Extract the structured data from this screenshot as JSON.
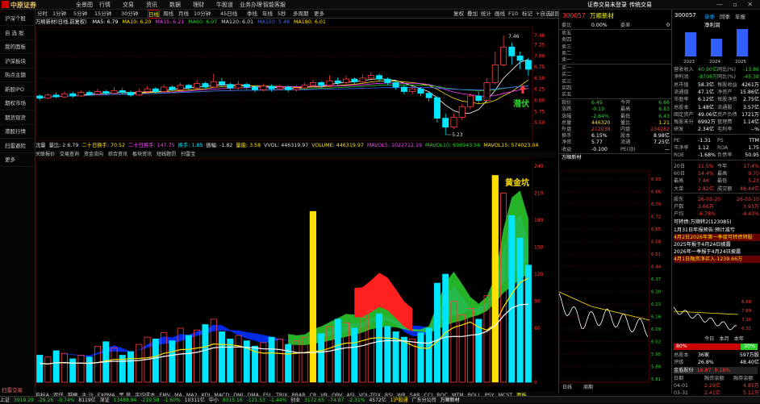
{
  "app": {
    "logo": "中原证券",
    "menus": [
      "全景图",
      "行情",
      "交易",
      "资讯",
      "数据",
      "理财",
      "牛股道",
      "业务办理",
      "智能客服"
    ],
    "right_menus": [
      "证券交易未登录",
      "传统交易"
    ],
    "window_controls": "— ▫ ✕"
  },
  "sidebar": {
    "items": [
      "沪深个股",
      "自 选 股",
      "我的面板",
      "沪深板块",
      "热点主题",
      "新股IPO",
      "期权市场",
      "期货现货",
      "港股行情",
      "扫雷避险",
      "更多"
    ],
    "bottom": "扫雷交易"
  },
  "toolbar": {
    "left": [
      "分时",
      "1分钟",
      "5分钟",
      "15分钟",
      "30分钟",
      "日线",
      "周线",
      "月线",
      "10分钟",
      "45日线",
      "季线",
      "年线",
      "5秒",
      "多周期",
      "更多"
    ],
    "active": "日线",
    "right": [
      "复权",
      "叠加",
      "统计",
      "画线",
      "F10",
      "标记",
      "+自选",
      "返回"
    ]
  },
  "chart_header": {
    "title": "万顺新材(日线,前复权)",
    "ma": [
      {
        "label": "MA5: 6.79",
        "color": "#ffffff"
      },
      {
        "label": "MA10: 6.20",
        "color": "#ffe000"
      },
      {
        "label": "MA15: 6.21",
        "color": "#ff40ff"
      },
      {
        "label": "MA60: 6.07",
        "color": "#2dd12d"
      },
      {
        "label": "MA120: 6.01",
        "color": "#dddddd"
      },
      {
        "label": "MA150: 5.48",
        "color": "#4060ff"
      },
      {
        "label": "MA180: 6.01",
        "color": "#ffe000"
      }
    ]
  },
  "chart_data": {
    "type": "candlestick",
    "y_ticks": [
      "7.46",
      "7.25",
      "7.00",
      "6.75",
      "6.50",
      "6.25",
      "6.00",
      "5.75",
      "5.50"
    ],
    "ylim": [
      5.23,
      7.55
    ],
    "annotations": {
      "high": "7.46",
      "low": "5.23",
      "pattern_label": "潜伏",
      "volume_label": "黄金坑"
    },
    "candles": [
      [
        6.1,
        6.05,
        6.14,
        6.0
      ],
      [
        6.05,
        6.12,
        6.16,
        6.02
      ],
      [
        6.12,
        6.08,
        6.18,
        6.05
      ],
      [
        6.08,
        6.15,
        6.2,
        6.05
      ],
      [
        6.15,
        6.1,
        6.2,
        6.06
      ],
      [
        6.1,
        6.18,
        6.22,
        6.08
      ],
      [
        6.18,
        6.14,
        6.22,
        6.1
      ],
      [
        6.14,
        6.2,
        6.26,
        6.12
      ],
      [
        6.2,
        6.16,
        6.24,
        6.12
      ],
      [
        6.16,
        6.22,
        6.3,
        6.14
      ],
      [
        6.22,
        6.18,
        6.28,
        6.14
      ],
      [
        6.18,
        6.12,
        6.22,
        6.08
      ],
      [
        6.12,
        6.2,
        6.26,
        6.1
      ],
      [
        6.2,
        6.26,
        6.32,
        6.16
      ],
      [
        6.26,
        6.2,
        6.3,
        6.16
      ],
      [
        6.2,
        6.3,
        6.36,
        6.18
      ],
      [
        6.3,
        6.24,
        6.34,
        6.2
      ],
      [
        6.24,
        6.34,
        6.4,
        6.22
      ],
      [
        6.34,
        6.28,
        6.38,
        6.22
      ],
      [
        6.28,
        6.38,
        6.46,
        6.26
      ],
      [
        6.38,
        6.3,
        6.42,
        6.26
      ],
      [
        6.3,
        6.42,
        6.6,
        6.28
      ],
      [
        6.42,
        6.36,
        6.5,
        6.3
      ],
      [
        6.36,
        6.28,
        6.4,
        6.22
      ],
      [
        6.28,
        6.36,
        6.44,
        6.24
      ],
      [
        6.36,
        6.3,
        6.4,
        6.24
      ],
      [
        6.3,
        6.24,
        6.34,
        6.18
      ],
      [
        6.24,
        6.32,
        6.38,
        6.2
      ],
      [
        6.32,
        6.26,
        6.36,
        6.2
      ],
      [
        6.26,
        6.3,
        6.36,
        6.22
      ],
      [
        6.3,
        6.24,
        6.34,
        6.18
      ],
      [
        6.24,
        6.28,
        6.34,
        6.2
      ],
      [
        6.28,
        6.34,
        6.4,
        6.24
      ],
      [
        6.34,
        6.4,
        6.46,
        6.3
      ],
      [
        6.4,
        6.34,
        6.44,
        6.28
      ],
      [
        6.34,
        6.44,
        6.56,
        6.3
      ],
      [
        6.44,
        6.4,
        6.52,
        6.34
      ],
      [
        6.4,
        6.48,
        6.56,
        6.36
      ],
      [
        6.48,
        6.42,
        6.52,
        6.36
      ],
      [
        6.42,
        6.5,
        6.58,
        6.38
      ],
      [
        6.5,
        6.56,
        6.64,
        6.44
      ],
      [
        6.56,
        6.48,
        6.6,
        6.42
      ],
      [
        6.48,
        6.4,
        6.52,
        6.34
      ],
      [
        6.4,
        6.3,
        6.44,
        6.24
      ],
      [
        6.3,
        6.2,
        6.34,
        6.14
      ],
      [
        6.2,
        6.26,
        6.32,
        6.14
      ],
      [
        6.26,
        6.16,
        6.3,
        6.1
      ],
      [
        6.16,
        6.06,
        6.2,
        5.98
      ],
      [
        6.06,
        5.6,
        6.1,
        5.5
      ],
      [
        5.6,
        5.4,
        5.7,
        5.23
      ],
      [
        5.4,
        5.62,
        5.7,
        5.36
      ],
      [
        5.62,
        5.86,
        5.92,
        5.56
      ],
      [
        5.86,
        6.1,
        6.16,
        5.8
      ],
      [
        6.1,
        6.0,
        6.2,
        5.94
      ],
      [
        6.0,
        6.4,
        6.5,
        5.96
      ],
      [
        6.4,
        6.8,
        7.1,
        6.36
      ],
      [
        6.8,
        7.2,
        7.46,
        6.76
      ],
      [
        7.2,
        7.0,
        7.3,
        6.8
      ],
      [
        7.0,
        6.9,
        7.1,
        6.7
      ],
      [
        6.9,
        6.7,
        6.96,
        6.55
      ]
    ],
    "volume_ticks": [
      "0",
      "60",
      "90",
      "120",
      "150",
      "180",
      "210",
      "240"
    ],
    "volumes": [
      30,
      28,
      35,
      32,
      26,
      30,
      28,
      40,
      45,
      38,
      30,
      34,
      42,
      50,
      48,
      55,
      46,
      60,
      52,
      58,
      64,
      70,
      56,
      48,
      52,
      46,
      40,
      44,
      50,
      48,
      42,
      46,
      50,
      58,
      54,
      62,
      70,
      66,
      60,
      72,
      80,
      76,
      62,
      56,
      50,
      48,
      55,
      60,
      110,
      120,
      90,
      75,
      82,
      70,
      96,
      140,
      210,
      185,
      160,
      130
    ],
    "volume_colors": "cyan=down,red=up"
  },
  "indicators": {
    "vol_row": [
      {
        "label": "沈量",
        "color": "#dddddd"
      },
      {
        "label": "量比: 2 6.79",
        "color": "#dddddd"
      },
      {
        "label": "二十日换手: 70.52",
        "color": "#ffe000"
      },
      {
        "label": "二十日换手: 147.75",
        "color": "#ff40ff"
      },
      {
        "label": "换手: 1.85",
        "color": "#00e5ff"
      },
      {
        "label": "振幅: -1.82",
        "color": "#dddddd"
      },
      {
        "label": "量能: 3.58",
        "color": "#ffe000"
      },
      {
        "label": "VVOL: 446319.97",
        "color": "#dddddd"
      },
      {
        "label": "VOLUME: 446319.97",
        "color": "#ffe000"
      },
      {
        "label": "MAVOL5: 1022712.19",
        "color": "#ff40ff"
      },
      {
        "label": "MAVOL10: 698943.56",
        "color": "#2dd12d"
      },
      {
        "label": "MAVOL15: 574023.04",
        "color": "#ffe000"
      }
    ],
    "tabs": [
      "指标A",
      "双仔",
      "越栅",
      "主 沙",
      "EXPMA",
      "黑 量",
      "平均成本",
      "EMV",
      "MA",
      "MA2",
      "KDJ",
      "MACD",
      "DMI",
      "DMA",
      "FSL",
      "TRIX",
      "BRAR",
      "CR",
      "VR",
      "OBV",
      "ASI",
      "VOL-TDX",
      "RSI",
      "WR",
      "SAR",
      "CCI",
      "ROC",
      "MTM",
      "BOLL",
      "PSY",
      "MCST",
      "面板"
    ],
    "tabs_active": "面板",
    "bottom": [
      "关联报价",
      "交易查询",
      "资金流向",
      "综合资讯",
      "板块资讯",
      "短线题罚",
      "扫雷宝"
    ]
  },
  "quote": {
    "code": "300057",
    "name": "万顺新材",
    "rows_top": [
      {
        "l": "委比",
        "m1": "0.00%",
        "m2": "委差",
        "m3": "0"
      }
    ],
    "asks": [
      {
        "l": "卖五",
        "m1": "",
        "m3": ""
      },
      {
        "l": "卖四",
        "m1": "",
        "m3": ""
      },
      {
        "l": "卖三",
        "m1": "",
        "m3": ""
      },
      {
        "l": "卖二",
        "m1": "",
        "m3": ""
      },
      {
        "l": "卖一",
        "m1": "",
        "m3": ""
      }
    ],
    "bids": [
      {
        "l": "买一",
        "m1": "",
        "m3": ""
      },
      {
        "l": "买二",
        "m1": "",
        "m3": ""
      },
      {
        "l": "买三",
        "m1": "",
        "m3": ""
      },
      {
        "l": "买四",
        "m1": "",
        "m3": ""
      },
      {
        "l": "买五",
        "m1": "",
        "m3": ""
      }
    ],
    "stats": [
      {
        "l": "现价",
        "m1": "6.49",
        "m2": "今开",
        "m3": "6.66"
      },
      {
        "l": "涨跌",
        "m1": "-0.19",
        "m2": "最高",
        "m3": "6.83"
      },
      {
        "l": "涨幅",
        "m1": "-2.84%",
        "m2": "最低",
        "m3": "6.43"
      },
      {
        "l": "总量",
        "m1": "446320",
        "m2": "量比",
        "m3": "1.21"
      },
      {
        "l": "外盘",
        "m1": "212038",
        "m2": "内盘",
        "m3": "234282"
      },
      {
        "l": "换手",
        "m1": "6.15%",
        "m2": "股本",
        "m3": "8.98亿"
      },
      {
        "l": "净资",
        "m1": "5.77",
        "m2": "流通",
        "m3": "7.25亿"
      },
      {
        "l": "收益",
        "m1": "-0.100",
        "m2": "PE(动)",
        "m3": "—"
      }
    ],
    "tick_title": "万顺新材",
    "tick_y": [
      "6.93",
      "6.86",
      "6.79",
      "6.72",
      "6.65",
      "6.58",
      "6.51",
      "6.44",
      "6.37",
      "6.30",
      "6.23",
      "6.16",
      "6.09",
      "6.02",
      "5.95",
      "5.88",
      "5.81"
    ],
    "bottom_tabs": [
      "日线",
      "周期"
    ]
  },
  "fin": {
    "code": "300057",
    "tabs": [
      "单季",
      "同季",
      "年报"
    ],
    "chart_title": "净利润",
    "years": [
      "2023",
      "2024",
      "2025"
    ],
    "rows": [
      {
        "a": "营收收入",
        "b": "40.90亿",
        "c": "同比(%)",
        "d": "-13.86"
      },
      {
        "a": "净利润",
        "b": "-8708万",
        "c": "同比(%)",
        "d": "-45.38"
      },
      {
        "a": "总市值",
        "b": "58.3亿",
        "c": "每股收益",
        "d": "4261万"
      },
      {
        "a": "流通值",
        "b": "47.1亿",
        "c": "净资产",
        "d": "15.86亿"
      },
      {
        "a": "市盈率",
        "b": "6.12亿",
        "c": "每股净资",
        "d": "2.75亿"
      },
      {
        "a": "总股本",
        "b": "1.48亿",
        "c": "流通股",
        "d": "3.57亿"
      },
      {
        "a": "固定资产",
        "b": "49.06亿",
        "c": "资产负债",
        "d": "1721万"
      },
      {
        "a": "每股未分",
        "b": "6992万",
        "c": "管理费",
        "d": "1.14亿"
      },
      {
        "a": "研发",
        "b": "2.34亿",
        "c": "毛利率",
        "d": "--%"
      }
    ],
    "rows2": [
      {
        "a": "PE",
        "b": "-1.31",
        "c": "PS",
        "d": "TTM"
      },
      {
        "a": "市净率",
        "b": "1.12",
        "c": "ROA",
        "d": "1.75"
      },
      {
        "a": "ROE",
        "b": "-1.68%",
        "c": "负债率",
        "d": "50.95"
      }
    ],
    "rows3": [
      {
        "a": "20日",
        "b": "11.5%",
        "c": "今年",
        "d": "17.4%"
      },
      {
        "a": "60日",
        "b": "14.4%",
        "c": "最高",
        "d": "9.70"
      },
      {
        "a": "最高",
        "b": "7.46",
        "c": "最低",
        "d": "5.23"
      },
      {
        "a": "大单",
        "b": "2.82亿",
        "c": "成交额",
        "d": "48.44亿"
      }
    ],
    "rows4": [
      {
        "a": "股东",
        "b": "26-03-20",
        "c": "",
        "d": "26-03-10"
      },
      {
        "a": "户数",
        "b": "3.66万",
        "c": "",
        "d": "3.93万"
      },
      {
        "a": "户均",
        "b": "-6.78%",
        "c": "",
        "d": "-4.43%"
      }
    ],
    "notice": "可转债:万顺转2(123085)",
    "news": [
      {
        "t": "1月31日年报预告:预计减亏",
        "color": "#ffffff"
      },
      {
        "t": "4月2日2026年第一季度可转债转股",
        "color": "#ffe000"
      },
      {
        "t": "2025年报于4月24日披露",
        "color": "#ffffff"
      },
      {
        "t": "2026年一季报于4月24日披露",
        "color": "#ffffff"
      },
      {
        "t": "4月1日融资净买入-1239.66万",
        "color": "#ffe000"
      }
    ],
    "mini_y": [
      "8.68",
      "7.89",
      "7.10",
      "6.31"
    ],
    "tabs2": [
      "今日",
      "本月",
      "本年"
    ],
    "gauge": {
      "left": "80%",
      "right": "20%",
      "left_frac": 0.8
    },
    "stats2": [
      {
        "a": "总股本",
        "b": "36家",
        "c": "",
        "d": "597万股"
      },
      {
        "a": "评级",
        "b": "26.8%",
        "c": "",
        "d": "48.40亿"
      }
    ],
    "compare": {
      "name": "金盾股份",
      "v1": "10.87",
      "v2": "0.18%"
    },
    "table_head": [
      "日期",
      "融资余额",
      "融券余额"
    ],
    "table": [
      {
        "a": "04-01",
        "b": "2.29亿",
        "d": "4.85万"
      },
      {
        "a": "03-31",
        "b": "2.41亿",
        "d": "5.12万"
      },
      {
        "a": "03-30",
        "b": "2.38亿",
        "d": "5.01万"
      }
    ]
  },
  "status": {
    "items": [
      {
        "t": "上证",
        "c": "#dddddd"
      },
      {
        "t": "3919.29",
        "c": "#2dd12d"
      },
      {
        "t": "-29.26",
        "c": "#2dd12d"
      },
      {
        "t": "-0.74%",
        "c": "#2dd12d"
      },
      {
        "t": "8119亿",
        "c": "#dddddd"
      },
      {
        "t": "深证",
        "c": "#dddddd"
      },
      {
        "t": "13488.94",
        "c": "#2dd12d"
      },
      {
        "t": "-219.58",
        "c": "#2dd12d"
      },
      {
        "t": "-1.60%",
        "c": "#2dd12d"
      },
      {
        "t": "10311亿",
        "c": "#dddddd"
      },
      {
        "t": "中小",
        "c": "#dddddd"
      },
      {
        "t": "8315.16",
        "c": "#2dd12d"
      },
      {
        "t": "-121.53",
        "c": "#2dd12d"
      },
      {
        "t": "-1.44%",
        "c": "#2dd12d"
      },
      {
        "t": "创业",
        "c": "#dddddd"
      },
      {
        "t": "3172.65",
        "c": "#2dd12d"
      },
      {
        "t": "-74.87",
        "c": "#2dd12d"
      },
      {
        "t": "-2.31%",
        "c": "#2dd12d"
      },
      {
        "t": "4572亿",
        "c": "#dddddd"
      },
      {
        "t": "1沪股通",
        "c": "#ffe000"
      },
      {
        "t": "广东分公司",
        "c": "#dddddd"
      },
      {
        "t": "万顺新材",
        "c": "#ffffff"
      }
    ]
  }
}
